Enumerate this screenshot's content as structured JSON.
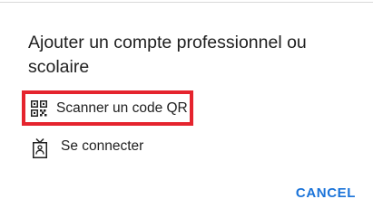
{
  "dialog": {
    "title": "Ajouter un compte professionnel ou scolaire",
    "options": [
      {
        "label": "Scanner un code QR",
        "icon": "qr-code-icon",
        "highlighted": true,
        "highlight_color": "#e5242e"
      },
      {
        "label": "Se connecter",
        "icon": "badge-icon",
        "highlighted": false
      }
    ],
    "cancel_label": "CANCEL",
    "accent_color": "#1a73d9"
  }
}
